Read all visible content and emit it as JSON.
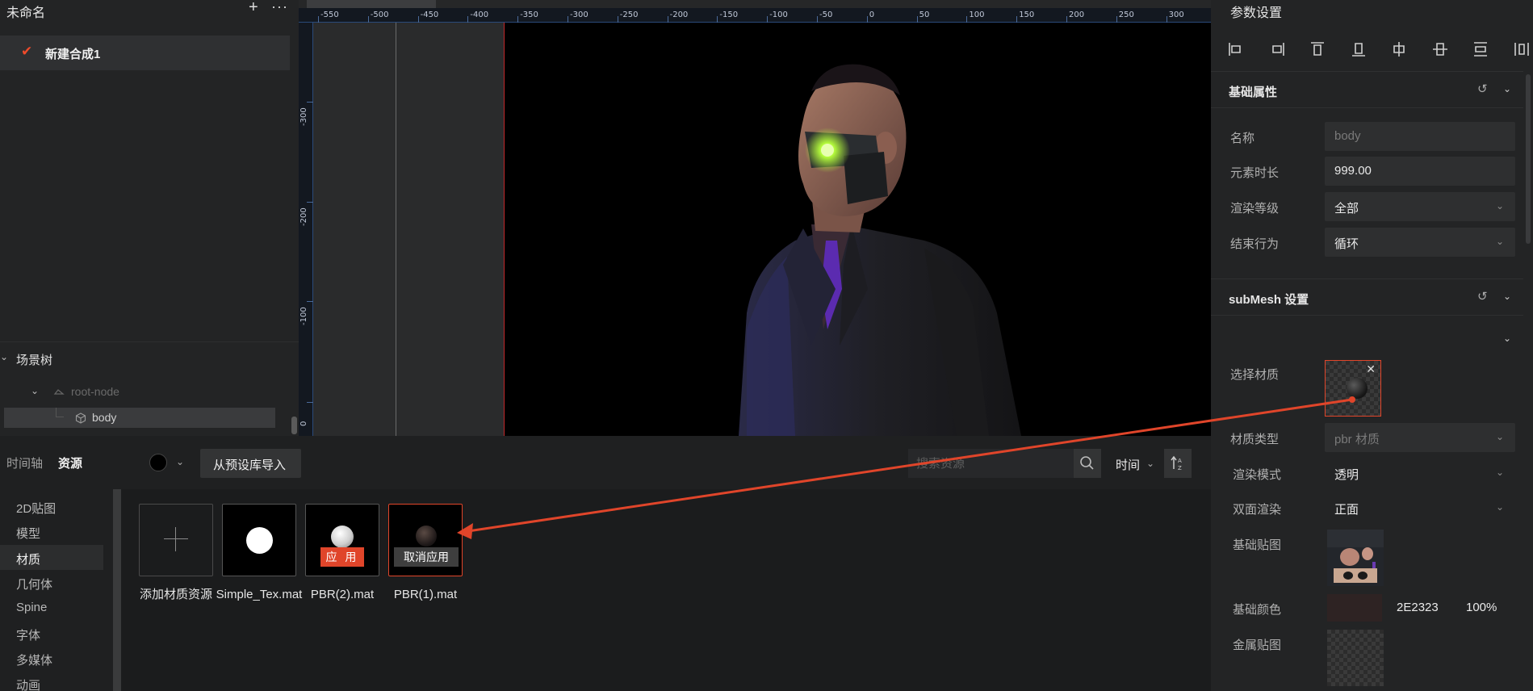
{
  "left_panel": {
    "title": "未命名",
    "add_glyph": "+",
    "more_glyph": "···",
    "composition_item": "新建合成1",
    "scene_tree": {
      "title": "场景树",
      "root_node": "root-node",
      "child_node": "body"
    }
  },
  "viewport": {
    "ruler_x_labels": [
      "-550",
      "-500",
      "-450",
      "-400",
      "-350",
      "-300",
      "-250",
      "-200",
      "-150",
      "-100",
      "-50",
      "0",
      "50",
      "100",
      "150",
      "200",
      "250",
      "300"
    ],
    "ruler_y_labels": [
      "-300",
      "-200",
      "-100",
      "0"
    ]
  },
  "bottom_panel": {
    "tabs": {
      "timeline": "时间轴",
      "assets": "资源"
    },
    "import_button": "从预设库导入",
    "search_placeholder": "搜索资源",
    "sort_select": "时间",
    "categories": [
      {
        "label": "2D贴图",
        "active": false
      },
      {
        "label": "模型",
        "active": false
      },
      {
        "label": "材质",
        "active": true
      },
      {
        "label": "几何体",
        "active": false
      },
      {
        "label": "Spine",
        "active": false
      },
      {
        "label": "字体",
        "active": false
      },
      {
        "label": "多媒体",
        "active": false
      },
      {
        "label": "动画",
        "active": false
      }
    ],
    "assets": [
      {
        "name": "添加材质资源",
        "icon": "plus-icon"
      },
      {
        "name": "Simple_Tex.mat",
        "icon": "white-circle-icon"
      },
      {
        "name": "PBR(2).mat",
        "icon": "material-sphere-icon",
        "badge": "应 用"
      },
      {
        "name": "PBR(1).mat",
        "icon": "material-sphere-icon",
        "badge": "取消应用",
        "selected": true
      }
    ]
  },
  "right_panel": {
    "title": "参数设置",
    "align_icons": [
      "align-left-icon",
      "align-right-icon",
      "align-top-icon",
      "align-bottom-icon",
      "align-horizontal-center-icon",
      "align-vertical-center-icon",
      "distribute-vertical-icon",
      "distribute-horizontal-icon"
    ],
    "basic_section": {
      "title": "基础属性",
      "name_label": "名称",
      "name_placeholder": "body",
      "duration_label": "元素时长",
      "duration_value": "999.00",
      "render_level_label": "渲染等级",
      "render_level_value": "全部",
      "end_behavior_label": "结束行为",
      "end_behavior_value": "循环"
    },
    "submesh_section": {
      "title": "subMesh 设置",
      "material_label": "选择材质",
      "material_type_label": "材质类型",
      "material_type_value": "pbr 材质",
      "render_mode_label": "渲染模式",
      "render_mode_value": "透明",
      "double_sided_label": "双面渲染",
      "double_sided_value": "正面",
      "base_texture_label": "基础贴图",
      "base_color_label": "基础颜色",
      "base_color_hex": "2E2323",
      "base_color_opacity": "100%",
      "metal_texture_label": "金属贴图"
    }
  },
  "colors": {
    "accent": "#e0452a",
    "base_color": "#2E2323",
    "panel_bg": "#232425"
  }
}
